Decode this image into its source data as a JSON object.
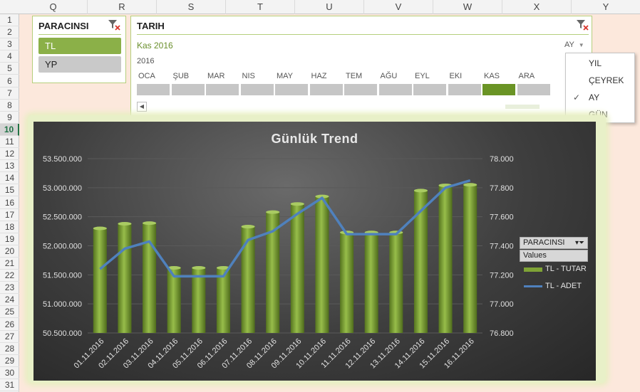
{
  "columns": [
    "Q",
    "R",
    "S",
    "T",
    "U",
    "V",
    "W",
    "X",
    "Y"
  ],
  "rows": [
    "1",
    "2",
    "3",
    "4",
    "5",
    "6",
    "7",
    "8",
    "9",
    "10",
    "11",
    "12",
    "13",
    "14",
    "15",
    "16",
    "17",
    "18",
    "19",
    "20",
    "21",
    "22",
    "23",
    "24",
    "25",
    "26",
    "27",
    "28",
    "29",
    "30",
    "31"
  ],
  "active_row": "10",
  "slicer": {
    "title": "PARACINSI",
    "items": [
      {
        "label": "TL",
        "selected": true
      },
      {
        "label": "YP",
        "selected": false
      }
    ]
  },
  "timeline": {
    "title": "TARIH",
    "range_label": "Kas 2016",
    "level_label": "AY",
    "year_label": "2016",
    "months": [
      "OCA",
      "ŞUB",
      "MAR",
      "NIS",
      "MAY",
      "HAZ",
      "TEM",
      "AĞU",
      "EYL",
      "EKI",
      "KAS",
      "ARA"
    ],
    "selected_month": "KAS"
  },
  "level_dropdown": {
    "items": [
      "YIL",
      "ÇEYREK",
      "AY",
      "GÜN"
    ],
    "checked": "AY"
  },
  "chart_data": {
    "type": "bar",
    "title": "Günlük Trend",
    "categories": [
      "01.11.2016",
      "02.11.2016",
      "03.11.2016",
      "04.11.2016",
      "05.11.2016",
      "06.11.2016",
      "07.11.2016",
      "08.11.2016",
      "09.11.2016",
      "10.11.2016",
      "11.11.2016",
      "12.11.2016",
      "13.11.2016",
      "14.11.2016",
      "15.11.2016",
      "16.11.2016"
    ],
    "series": [
      {
        "name": "TL - TUTAR",
        "type": "bar",
        "axis": "left",
        "color": "#7fa336",
        "values": [
          52300000,
          52380000,
          52390000,
          51620000,
          51620000,
          51620000,
          52330000,
          52580000,
          52720000,
          52850000,
          52230000,
          52230000,
          52230000,
          52950000,
          53040000,
          53050000
        ]
      },
      {
        "name": "TL - ADET",
        "type": "line",
        "axis": "right",
        "color": "#4f81bd",
        "values": [
          77240,
          77380,
          77430,
          77190,
          77190,
          77190,
          77440,
          77500,
          77620,
          77730,
          77480,
          77480,
          77480,
          77640,
          77800,
          77850
        ]
      }
    ],
    "y_left": {
      "min": 50500000,
      "max": 53500000,
      "ticks": [
        "50.500.000",
        "51.000.000",
        "51.500.000",
        "52.000.000",
        "52.500.000",
        "53.000.000",
        "53.500.000"
      ]
    },
    "y_right": {
      "min": 76800,
      "max": 78000,
      "ticks": [
        "76.800",
        "77.000",
        "77.200",
        "77.400",
        "77.600",
        "77.800",
        "78.000"
      ]
    },
    "grid": true,
    "legend_position": "right",
    "legend_button": "PARACINSI",
    "legend_values_label": "Values"
  }
}
